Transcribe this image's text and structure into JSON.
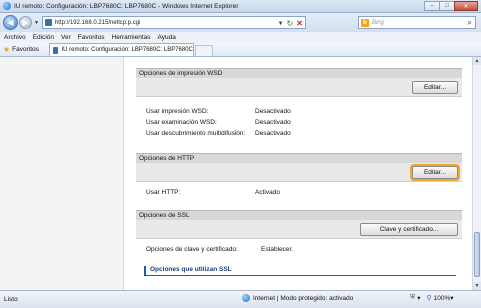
{
  "window": {
    "title": "IU remoto: Configuración: LBP7680C: LBP7680C - Windows Internet Explorer",
    "min_glyph": "–",
    "max_glyph": "□",
    "close_glyph": "✕"
  },
  "address_bar": {
    "url": "http://192.168.0.215/netlcp.p.cgi",
    "search_placeholder": "Bing",
    "back_glyph": "◀",
    "forward_glyph": "▶",
    "dropdown_glyph": "▼",
    "refresh_glyph": "↻",
    "stop_glyph": "✕",
    "search_glyph": "⌕",
    "search_provider_glyph": "b"
  },
  "menu": {
    "items": [
      "Archivo",
      "Edición",
      "Ver",
      "Favoritos",
      "Herramientas",
      "Ayuda"
    ]
  },
  "favorites_bar": {
    "favorites_label": "Favoritos",
    "star_glyph": "★",
    "tab_title": "IU remoto: Configuración: LBP7680C: LBP7680C"
  },
  "sections": {
    "wsd": {
      "title": "Opciones de impresión WSD",
      "edit_label": "Editar...",
      "rows": [
        {
          "label": "Usar impresión WSD:",
          "value": "Desactivado"
        },
        {
          "label": "Usar examinación WSD:",
          "value": "Desactivado"
        },
        {
          "label": "Usar descubrimiento multidifusión:",
          "value": "Desactivado"
        }
      ]
    },
    "http": {
      "title": "Opciones de HTTP",
      "edit_label": "Editar...",
      "rows": [
        {
          "label": "Usar HTTP:",
          "value": "Activado"
        }
      ]
    },
    "ssl": {
      "title": "Opciones de SSL",
      "edit_label": "Clave y certificado...",
      "rows": [
        {
          "label": "Opciones de clave y certificado:",
          "value": "Establecer."
        }
      ],
      "subsection_title": "Opciones que utilizan SSL"
    }
  },
  "status_bar": {
    "status": "Listo",
    "zone": "Internet | Modo protegido: activado",
    "zoom": "100%",
    "shield_glyph": "⛨",
    "zoom_glyph": "⚲",
    "menu_glyph": "▾"
  },
  "scrollbar": {
    "up_glyph": "▲",
    "down_glyph": "▼"
  }
}
